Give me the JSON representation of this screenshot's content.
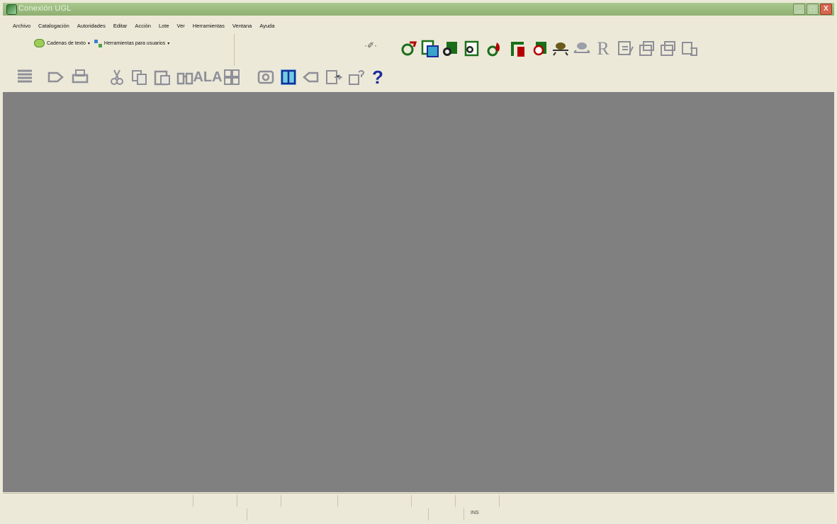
{
  "window": {
    "title": "Conexión UGL",
    "buttons": {
      "minimize": "_",
      "maximize": "□",
      "close": "X"
    }
  },
  "menu": {
    "items": [
      "Archivo",
      "Catalogación",
      "Autoridades",
      "Editar",
      "Acción",
      "Lote",
      "Ver",
      "Herramientas",
      "Ventana",
      "Ayuda"
    ]
  },
  "toolbar1": {
    "text_strings_label": "Cadenas de texto",
    "user_tools_label": "Herramientas para usuarios",
    "arrow": "▾",
    "dropdown_glyph": "·✐·"
  },
  "toolbar_icons": {
    "row1": [
      "record-clip-icon",
      "green-document-icon",
      "open-folder-b-icon",
      "open-folder-b2-icon",
      "flame-search-icon",
      "red-chart-icon",
      "open-folder-r-icon",
      "eye-link-icon",
      "double-arrow-icon",
      "r-letter-icon",
      "edit-book-icon",
      "paper-fold-icon",
      "paper-fold2-icon",
      "copy-record-icon"
    ],
    "row2": [
      "list-icon",
      "arrow-right-icon",
      "printer-icon",
      "cut-icon",
      "copy-icon",
      "paste-icon",
      "binoculars-icon",
      "ala-icon",
      "grid-icon",
      "c-icon",
      "book-icon",
      "left-arrow-icon",
      "send-icon",
      "help-question-icon",
      "blue-question-icon"
    ],
    "r_letter": "R",
    "ala_label": "ALA",
    "question_mark": "?",
    "help_q": "?"
  },
  "statusbar": {
    "ins_label": "INS"
  },
  "colors": {
    "titlebar": "#8fb070",
    "workspace": "#808080",
    "chrome": "#ece9d8",
    "icon_blue": "#1a2a9c",
    "icon_gray": "#8e8f99",
    "icon_red": "#b30000",
    "icon_green": "#1a6e1a"
  }
}
